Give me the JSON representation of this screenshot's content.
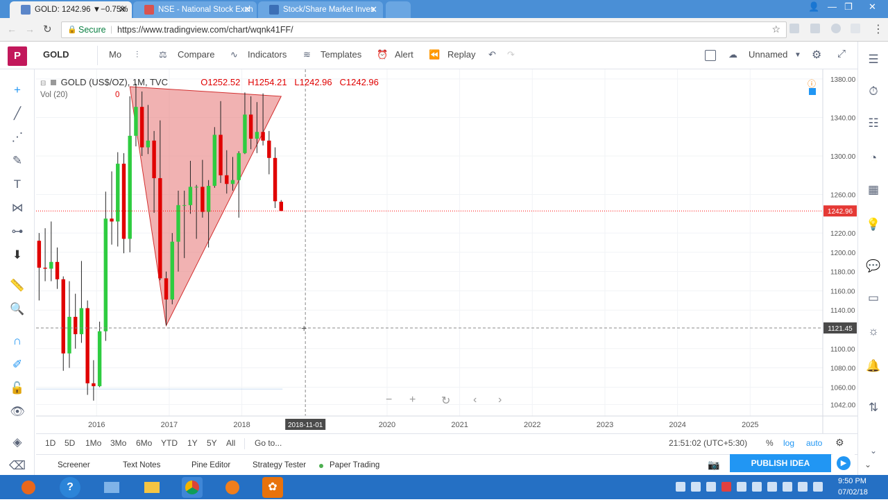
{
  "browser": {
    "tabs": [
      {
        "label": "GOLD: 1242.96 ▼−0.75%",
        "active": true
      },
      {
        "label": "NSE - National Stock Exch",
        "active": false
      },
      {
        "label": "Stock/Share Market Inves",
        "active": false
      }
    ],
    "secure_label": "Secure",
    "url": "https://www.tradingview.com/chart/wqnk41FF/"
  },
  "toolbar": {
    "logo": "P",
    "symbol": "GOLD",
    "interval": "Mo",
    "compare": "Compare",
    "indicators": "Indicators",
    "templates": "Templates",
    "alert": "Alert",
    "replay": "Replay",
    "layout_name": "Unnamed"
  },
  "legend": {
    "title": "GOLD (US$/OZ), 1M, TVC",
    "open": "O1252.52",
    "high": "H1254.21",
    "low": "L1242.96",
    "close": "C1242.96",
    "volume": "Vol (20)",
    "volume_value": "0"
  },
  "price_axis": {
    "ticks": [
      "1380.00",
      "1340.00",
      "1300.00",
      "1260.00",
      "1220.00",
      "1200.00",
      "1180.00",
      "1160.00",
      "1140.00",
      "1100.00",
      "1080.00",
      "1060.00",
      "1042.00"
    ],
    "last_price_label": "1242.96",
    "cursor_price_label": "1121.45"
  },
  "time_axis": {
    "ticks": [
      "2016",
      "2017",
      "2018",
      "2020",
      "2021",
      "2022",
      "2023",
      "2024",
      "2025"
    ],
    "cursor_date_label": "2018-11-01"
  },
  "chart_data": {
    "type": "candlestick",
    "title": "GOLD (US$/OZ), 1M, TVC",
    "series_unit": "US$/OZ",
    "ylim": [
      1030,
      1390
    ],
    "x_range": [
      "2015-03",
      "2025-12"
    ],
    "last_price": 1242.96,
    "cursor_price": 1121.45,
    "cursor_date": "2018-11-01",
    "candles": [
      {
        "t": "2015-03",
        "o": 1212,
        "h": 1220,
        "l": 1150,
        "c": 1184
      },
      {
        "t": "2015-04",
        "o": 1184,
        "h": 1225,
        "l": 1170,
        "c": 1183
      },
      {
        "t": "2015-05",
        "o": 1183,
        "h": 1232,
        "l": 1170,
        "c": 1190
      },
      {
        "t": "2015-06",
        "o": 1190,
        "h": 1205,
        "l": 1162,
        "c": 1172
      },
      {
        "t": "2015-07",
        "o": 1172,
        "h": 1175,
        "l": 1077,
        "c": 1095
      },
      {
        "t": "2015-08",
        "o": 1095,
        "h": 1170,
        "l": 1080,
        "c": 1133
      },
      {
        "t": "2015-09",
        "o": 1133,
        "h": 1157,
        "l": 1100,
        "c": 1115
      },
      {
        "t": "2015-10",
        "o": 1115,
        "h": 1191,
        "l": 1106,
        "c": 1142
      },
      {
        "t": "2015-11",
        "o": 1142,
        "h": 1150,
        "l": 1052,
        "c": 1064
      },
      {
        "t": "2015-12",
        "o": 1064,
        "h": 1088,
        "l": 1046,
        "c": 1061
      },
      {
        "t": "2016-01",
        "o": 1061,
        "h": 1128,
        "l": 1060,
        "c": 1118
      },
      {
        "t": "2016-02",
        "o": 1118,
        "h": 1263,
        "l": 1108,
        "c": 1235
      },
      {
        "t": "2016-03",
        "o": 1235,
        "h": 1284,
        "l": 1208,
        "c": 1232
      },
      {
        "t": "2016-04",
        "o": 1232,
        "h": 1304,
        "l": 1206,
        "c": 1292
      },
      {
        "t": "2016-05",
        "o": 1292,
        "h": 1303,
        "l": 1199,
        "c": 1214
      },
      {
        "t": "2016-06",
        "o": 1214,
        "h": 1362,
        "l": 1200,
        "c": 1321
      },
      {
        "t": "2016-07",
        "o": 1321,
        "h": 1375,
        "l": 1310,
        "c": 1351
      },
      {
        "t": "2016-08",
        "o": 1351,
        "h": 1367,
        "l": 1300,
        "c": 1309
      },
      {
        "t": "2016-09",
        "o": 1309,
        "h": 1353,
        "l": 1302,
        "c": 1316
      },
      {
        "t": "2016-10",
        "o": 1316,
        "h": 1326,
        "l": 1241,
        "c": 1277
      },
      {
        "t": "2016-11",
        "o": 1277,
        "h": 1337,
        "l": 1171,
        "c": 1173
      },
      {
        "t": "2016-12",
        "o": 1173,
        "h": 1180,
        "l": 1124,
        "c": 1151
      },
      {
        "t": "2017-01",
        "o": 1151,
        "h": 1220,
        "l": 1146,
        "c": 1211
      },
      {
        "t": "2017-02",
        "o": 1211,
        "h": 1264,
        "l": 1180,
        "c": 1249
      },
      {
        "t": "2017-03",
        "o": 1249,
        "h": 1264,
        "l": 1194,
        "c": 1249
      },
      {
        "t": "2017-04",
        "o": 1249,
        "h": 1295,
        "l": 1240,
        "c": 1268
      },
      {
        "t": "2017-05",
        "o": 1268,
        "h": 1270,
        "l": 1214,
        "c": 1268
      },
      {
        "t": "2017-06",
        "o": 1268,
        "h": 1296,
        "l": 1236,
        "c": 1242
      },
      {
        "t": "2017-07",
        "o": 1242,
        "h": 1275,
        "l": 1205,
        "c": 1269
      },
      {
        "t": "2017-08",
        "o": 1269,
        "h": 1330,
        "l": 1267,
        "c": 1322
      },
      {
        "t": "2017-09",
        "o": 1322,
        "h": 1357,
        "l": 1272,
        "c": 1280
      },
      {
        "t": "2017-10",
        "o": 1280,
        "h": 1306,
        "l": 1261,
        "c": 1271
      },
      {
        "t": "2017-11",
        "o": 1271,
        "h": 1299,
        "l": 1264,
        "c": 1275
      },
      {
        "t": "2017-12",
        "o": 1275,
        "h": 1305,
        "l": 1236,
        "c": 1303
      },
      {
        "t": "2018-01",
        "o": 1303,
        "h": 1366,
        "l": 1302,
        "c": 1343
      },
      {
        "t": "2018-02",
        "o": 1343,
        "h": 1362,
        "l": 1307,
        "c": 1318
      },
      {
        "t": "2018-03",
        "o": 1318,
        "h": 1356,
        "l": 1303,
        "c": 1325
      },
      {
        "t": "2018-04",
        "o": 1325,
        "h": 1365,
        "l": 1311,
        "c": 1316
      },
      {
        "t": "2018-05",
        "o": 1316,
        "h": 1326,
        "l": 1281,
        "c": 1298
      },
      {
        "t": "2018-06",
        "o": 1298,
        "h": 1309,
        "l": 1246,
        "c": 1253
      },
      {
        "t": "2018-07",
        "o": 1252.52,
        "h": 1254.21,
        "l": 1242.96,
        "c": 1242.96
      }
    ],
    "drawings": [
      {
        "type": "triangle",
        "points": [
          [
            "2016-06",
            1372
          ],
          [
            "2016-12",
            1124
          ],
          [
            "2018-07",
            1362
          ]
        ],
        "color": "#e57373"
      }
    ],
    "colors": {
      "up": "#26a69a",
      "up_bright": "#2ecc40",
      "down": "#e00000",
      "last_price_line": "#ff0000"
    }
  },
  "bottom": {
    "ranges": [
      "1D",
      "5D",
      "1Mo",
      "3Mo",
      "6Mo",
      "YTD",
      "1Y",
      "5Y",
      "All"
    ],
    "goto": "Go to...",
    "clock": "21:51:02 (UTC+5:30)",
    "percent": "%",
    "log": "log",
    "auto": "auto"
  },
  "panels": {
    "screener": "Screener",
    "text_notes": "Text Notes",
    "pine_editor": "Pine Editor",
    "strategy_tester": "Strategy Tester",
    "paper_trading": "Paper Trading",
    "publish": "PUBLISH IDEA"
  },
  "taskbar": {
    "time": "9:50 PM",
    "date": "07/02/18"
  }
}
